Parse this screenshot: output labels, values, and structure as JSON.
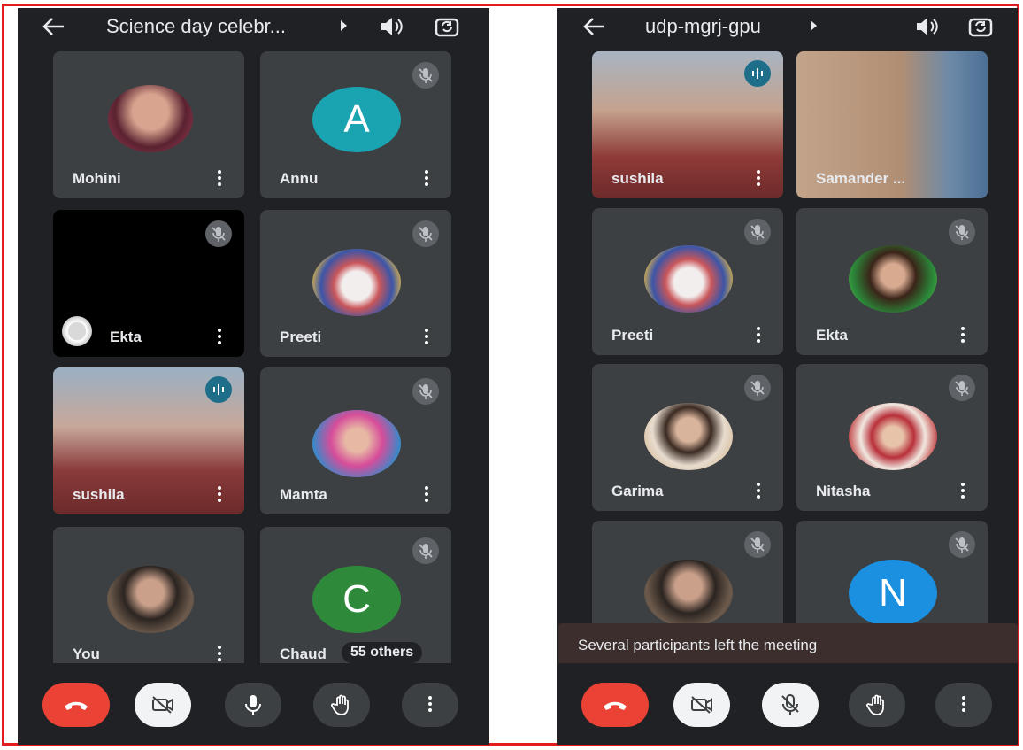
{
  "left": {
    "title": "Science day celebr...",
    "tiles": [
      {
        "name": "Mohini"
      },
      {
        "name": "Annu",
        "initial": "A"
      },
      {
        "name": "Ekta"
      },
      {
        "name": "Preeti"
      },
      {
        "name": "sushila"
      },
      {
        "name": "Mamta"
      },
      {
        "name": "You"
      },
      {
        "name": "Chaud",
        "initial": "C",
        "others": "55 others"
      }
    ]
  },
  "right": {
    "title": "udp-mgrj-gpu",
    "tiles": [
      {
        "name": "sushila"
      },
      {
        "name": "Samander ..."
      },
      {
        "name": "Preeti"
      },
      {
        "name": "Ekta"
      },
      {
        "name": "Garima"
      },
      {
        "name": "Nitasha"
      },
      {
        "name": ""
      },
      {
        "name": "",
        "initial": "N"
      }
    ],
    "toast": "Several participants left the meeting"
  },
  "colors": {
    "background": "#202124",
    "tile": "#3c4043",
    "end_call": "#ea4335",
    "avatar_annu": "#1aa3b0",
    "avatar_c": "#2e8a3a",
    "avatar_n": "#1b8fe0",
    "frame": "#e21c1c"
  }
}
